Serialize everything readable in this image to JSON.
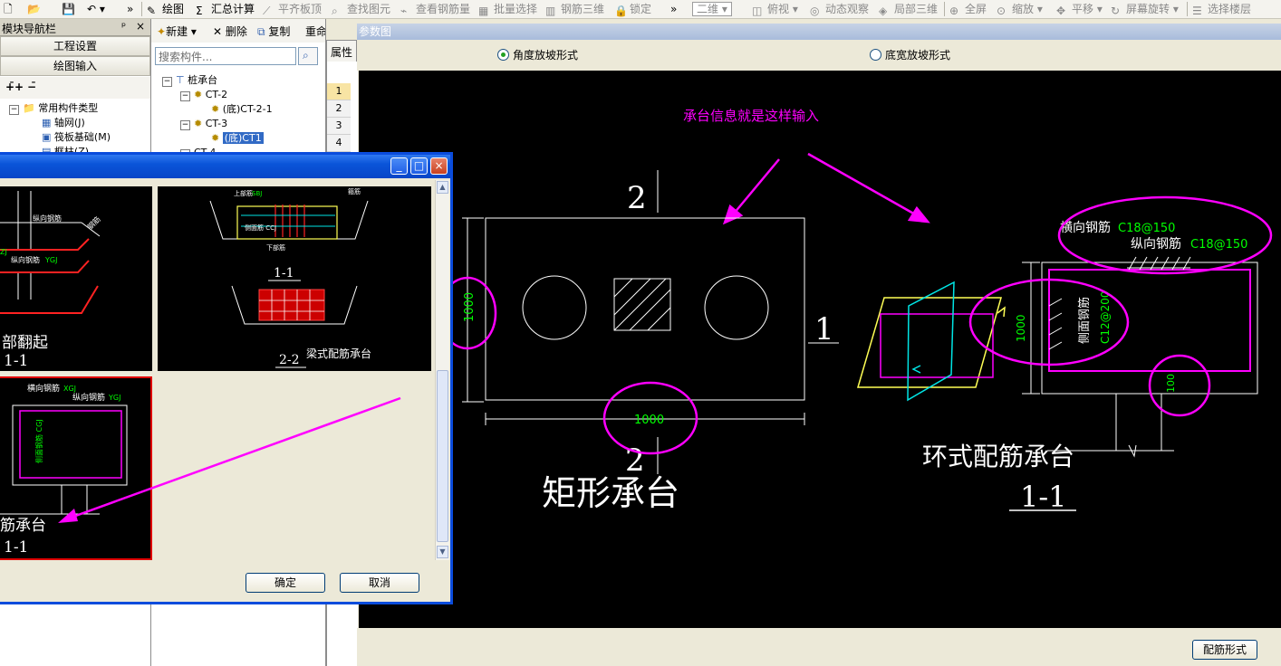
{
  "toolbar": {
    "items": [
      {
        "label": "绘图",
        "icon": "draw-icon"
      },
      {
        "label": "汇总计算",
        "icon": "sum-icon"
      },
      {
        "label": "平齐板顶",
        "icon": "flush-icon"
      },
      {
        "label": "查找图元",
        "icon": "find-icon"
      },
      {
        "label": "查看钢筋量",
        "icon": "view-rebar-icon"
      },
      {
        "label": "批量选择",
        "icon": "batch-select-icon"
      },
      {
        "label": "钢筋三维",
        "icon": "rebar-3d-icon"
      },
      {
        "label": "锁定",
        "icon": "lock-icon"
      },
      {
        "label": "二维",
        "icon": "2d-icon"
      },
      {
        "label": "俯视",
        "icon": "top-view-icon"
      },
      {
        "label": "动态观察",
        "icon": "orbit-icon"
      },
      {
        "label": "局部三维",
        "icon": "local-3d-icon"
      },
      {
        "label": "全屏",
        "icon": "fullscreen-icon"
      },
      {
        "label": "缩放",
        "icon": "zoom-icon"
      },
      {
        "label": "平移",
        "icon": "pan-icon"
      },
      {
        "label": "屏幕旋转",
        "icon": "rotate-icon"
      },
      {
        "label": "选择楼层",
        "icon": "floor-icon"
      }
    ]
  },
  "nav": {
    "title": "模块导航栏",
    "pin": "ᵖ",
    "close": "×",
    "project_settings": "工程设置",
    "drawing_input": "绘图输入",
    "tree": {
      "root": "常用构件类型",
      "items": [
        "轴网(J)",
        "筏板基础(M)",
        "框柱(Z)"
      ]
    }
  },
  "components": {
    "new": "新建",
    "delete": "删除",
    "copy": "复制",
    "rename": "重命名",
    "search_placeholder": "搜索构件...",
    "tree": {
      "root": "桩承台",
      "group1": "CT-2",
      "item1": "(底)CT-2-1",
      "group2": "CT-3",
      "item2": "(底)CT1",
      "group3": "CT-4"
    }
  },
  "property": {
    "tab": "属性",
    "rows": [
      "1",
      "2",
      "3",
      "4"
    ]
  },
  "param": {
    "title": "参数图",
    "radio_angle": "角度放坡形式",
    "radio_width": "底宽放坡形式",
    "rebar_button": "配筋形式",
    "annotation": "承台信息就是这样输入",
    "section_top": "2",
    "section_right": "1",
    "section_bottom": "2",
    "dim_height": "1000",
    "dim_width": "1000",
    "rect_title": "矩形承台",
    "ring_title": "环式配筋承台",
    "ring_section": "1-1",
    "transverse_label": "横向钢筋",
    "transverse_value": "C18@150",
    "longitudinal_label": "纵向钢筋",
    "longitudinal_value": "C18@150",
    "side_label": "侧面钢筋",
    "side_value": "C12@200",
    "ring_height": "1000",
    "ring_cover": "100"
  },
  "dialog": {
    "minimize": "_",
    "maximize": "□",
    "close": "×",
    "thumb1_text": "部翻起",
    "thumb1_section": "1-1",
    "thumb2_section_a": "1-1",
    "thumb2_section_b": "2-2",
    "thumb2_caption": "梁式配筋承台",
    "thumb3_text": "筋承台",
    "thumb3_section": "1-1",
    "thumb3_label_a": "横向钢筋",
    "thumb3_label_b": "纵向钢筋",
    "ok": "确定",
    "cancel": "取消"
  },
  "colors": {
    "annotation": "#ff00ff",
    "dim_text": "#00ff00",
    "title_bar": "#0a54d8",
    "canvas": "#000000"
  }
}
